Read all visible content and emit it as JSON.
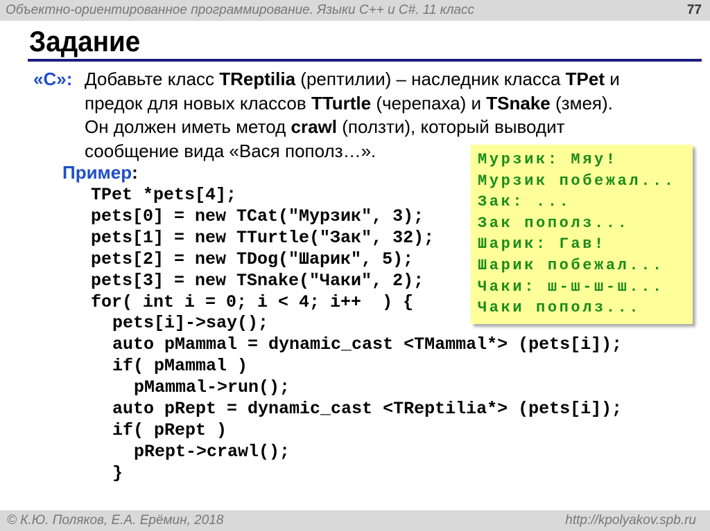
{
  "header": {
    "course": "Объектно-ориентированное программирование. Языки C++ и C#. 11 класс",
    "page": "77"
  },
  "title": "Задание",
  "task": {
    "label": "«C»:",
    "lines": [
      [
        "Добавьте класс ",
        "TReptilia",
        " (рептилии) – наследник класса ",
        "TPet",
        " и"
      ],
      [
        "предок для новых классов ",
        "TTurtle",
        " (черепаха) и ",
        "TSnake",
        " (змея)."
      ],
      [
        "Он должен иметь метод ",
        "crawl",
        " (ползти), который выводит",
        "",
        ""
      ],
      [
        "сообщение вида «Вася пополз…».",
        "",
        "",
        "",
        ""
      ]
    ]
  },
  "example_label": "Пример",
  "example_colon": ":",
  "code": [
    {
      "indent": 0,
      "text": "TPet *pets[4];"
    },
    {
      "indent": 0,
      "text": "pets[0] = new TCat(\"Мурзик\", 3);"
    },
    {
      "indent": 0,
      "text": "pets[1] = new TTurtle(\"Зак\", 32);"
    },
    {
      "indent": 0,
      "text": "pets[2] = new TDog(\"Шарик\", 5);"
    },
    {
      "indent": 0,
      "text": "pets[3] = new TSnake(\"Чаки\", 2);"
    },
    {
      "indent": 0,
      "text": "for( int i = 0; i < 4; i++  ) {"
    },
    {
      "indent": 1,
      "text": "pets[i]->say();"
    },
    {
      "indent": 1,
      "text": "auto pMammal = dynamic_cast <TMammal*> (pets[i]);"
    },
    {
      "indent": 1,
      "text": "if( pMammal )"
    },
    {
      "indent": 2,
      "text": "pMammal->run();"
    },
    {
      "indent": 1,
      "text": "auto pRept = dynamic_cast <TReptilia*> (pets[i]);"
    },
    {
      "indent": 1,
      "text": "if( pRept )"
    },
    {
      "indent": 2,
      "text": "pRept->crawl();"
    },
    {
      "indent": 1,
      "text": "}"
    }
  ],
  "output": [
    "Мурзик: Мяу!",
    "Мурзик побежал...",
    "Зак: ...",
    "Зак пополз...",
    "Шарик: Гав!",
    "Шарик побежал...",
    "Чаки: ш-ш-ш-ш...",
    "Чаки пополз..."
  ],
  "footer": {
    "authors": "© К.Ю. Поляков, Е.А. Ерёмин, 2018",
    "url": "http://kpolyakov.spb.ru"
  }
}
